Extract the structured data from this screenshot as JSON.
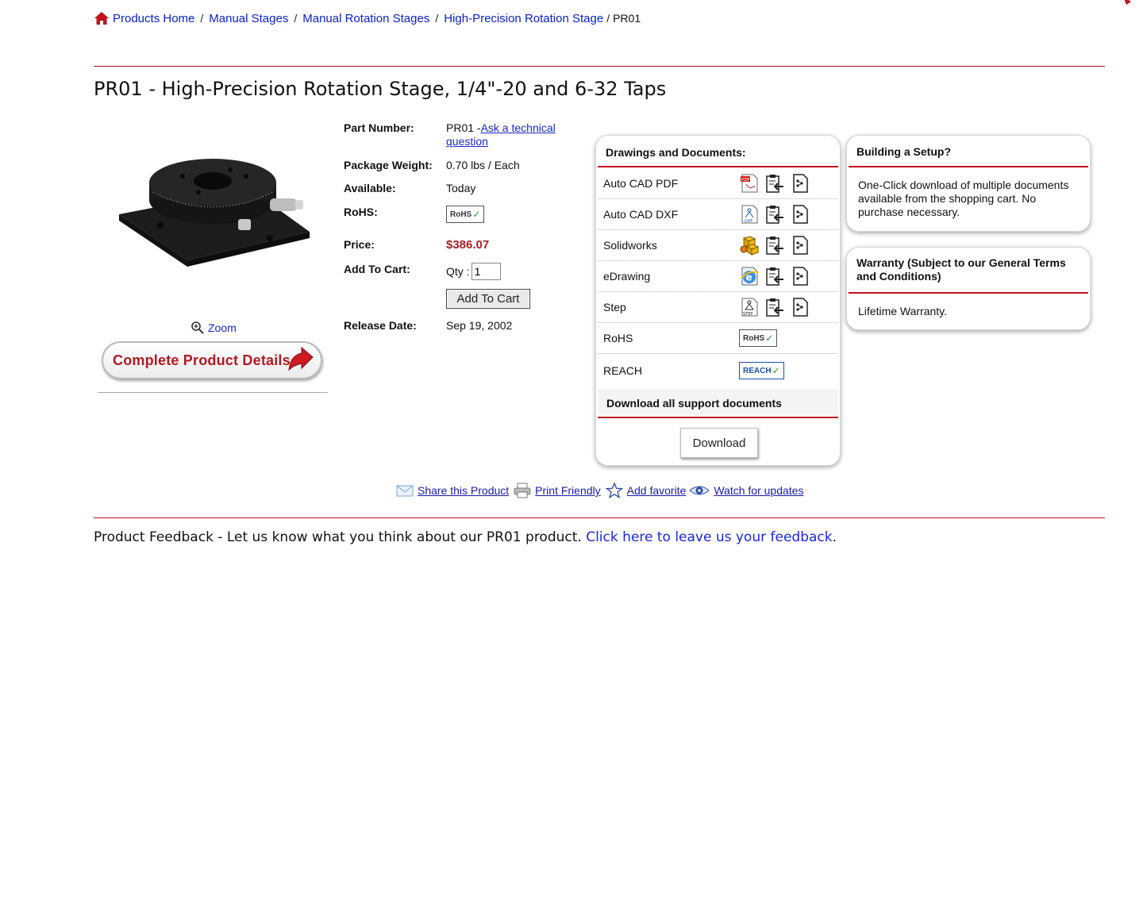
{
  "breadcrumb": {
    "items": [
      "Products Home",
      "Manual Stages",
      "Manual Rotation Stages",
      "High-Precision Rotation Stage"
    ],
    "separator": "/",
    "current": "PR01"
  },
  "page_title": "PR01 - High-Precision Rotation Stage, 1/4\"-20 and 6-32 Taps",
  "image": {
    "zoom_label": "Zoom",
    "details_button": "Complete Product Details"
  },
  "specs": {
    "part_number_label": "Part Number:",
    "part_number": "PR01 -",
    "ask_link": "Ask a technical question",
    "weight_label": "Package Weight:",
    "weight": "0.70 lbs / Each",
    "available_label": "Available:",
    "available": "Today",
    "rohs_label": "RoHS:",
    "rohs_badge": "RoHS",
    "price_label": "Price:",
    "price": "$386.07",
    "cart_label": "Add To Cart:",
    "qty_label": "Qty :",
    "qty_value": "1",
    "cart_button": "Add To Cart",
    "release_label": "Release Date:",
    "release_date": "Sep 19, 2002"
  },
  "docs_panel": {
    "title": "Drawings and Documents:",
    "rows": [
      {
        "name": "Auto CAD PDF",
        "icons": [
          "pdf-file-icon",
          "clipboard-arrow-icon",
          "file-share-icon"
        ]
      },
      {
        "name": "Auto CAD DXF",
        "icons": [
          "dxf-file-icon",
          "clipboard-arrow-icon",
          "file-share-icon"
        ]
      },
      {
        "name": "Solidworks",
        "icons": [
          "solidworks-icon",
          "clipboard-arrow-icon",
          "file-share-icon"
        ]
      },
      {
        "name": "eDrawing",
        "icons": [
          "edrawing-icon",
          "clipboard-arrow-icon",
          "file-share-icon"
        ]
      },
      {
        "name": "Step",
        "icons": [
          "step-file-icon",
          "clipboard-arrow-icon",
          "file-share-icon"
        ]
      },
      {
        "name": "RoHS",
        "badge": "RoHS"
      },
      {
        "name": "REACH",
        "badge": "REACH"
      }
    ],
    "download_all": "Download all support documents",
    "download_button": "Download"
  },
  "setup_panel": {
    "title": "Building a Setup?",
    "body": "One-Click download of multiple documents available from the shopping cart. No purchase necessary."
  },
  "warranty_panel": {
    "title": "Warranty (Subject to our General Terms and Conditions)",
    "body": "Lifetime Warranty."
  },
  "actions": {
    "share": "Share this Product",
    "print": "Print Friendly",
    "favorite": "Add favorite",
    "watch": "Watch for updates"
  },
  "feedback": {
    "text": "Product Feedback - Let us know what you think about our PR01 product. ",
    "link": "Click here to leave us your feedback",
    "end": "."
  },
  "colors": {
    "accent_red": "#c0121f",
    "price_red": "#a81e24",
    "link_blue": "#1a28c8"
  }
}
